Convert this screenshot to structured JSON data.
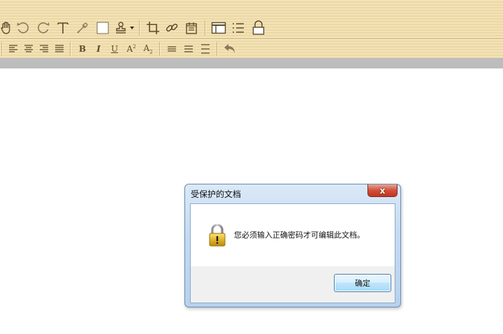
{
  "toolbar": {
    "row1_icons": [
      "hand-icon",
      "rotate-left-icon",
      "rotate-right-icon",
      "text-tool-icon",
      "eyedropper-icon",
      "rectangle-icon",
      "stamp-icon",
      "crop-icon",
      "link-icon",
      "calendar-icon",
      "layout-icon",
      "list-icon",
      "lock-icon"
    ],
    "row2_icons": [
      "align-left-icon",
      "align-center-icon",
      "align-right-icon",
      "align-justify-icon",
      "bold-icon",
      "italic-icon",
      "underline-icon",
      "superscript-icon",
      "subscript-icon",
      "line-spacing-icon",
      "paragraph-spacing-icon",
      "indent-icon",
      "undo-icon"
    ],
    "bold_label": "B",
    "italic_label": "I",
    "underline_label": "U",
    "super_base": "A",
    "super_exp": "2",
    "sub_base": "A",
    "sub_exp": "2"
  },
  "dialog": {
    "title": "受保护的文档",
    "close_label": "x",
    "message": "您必须输入正确密码才可编辑此文档。",
    "ok_label": "确定"
  },
  "colors": {
    "toolbar_bg": "#f0deae",
    "icon": "#5a4a2a",
    "dialog_frame": "#c4dbf3",
    "close_red": "#c23520"
  }
}
